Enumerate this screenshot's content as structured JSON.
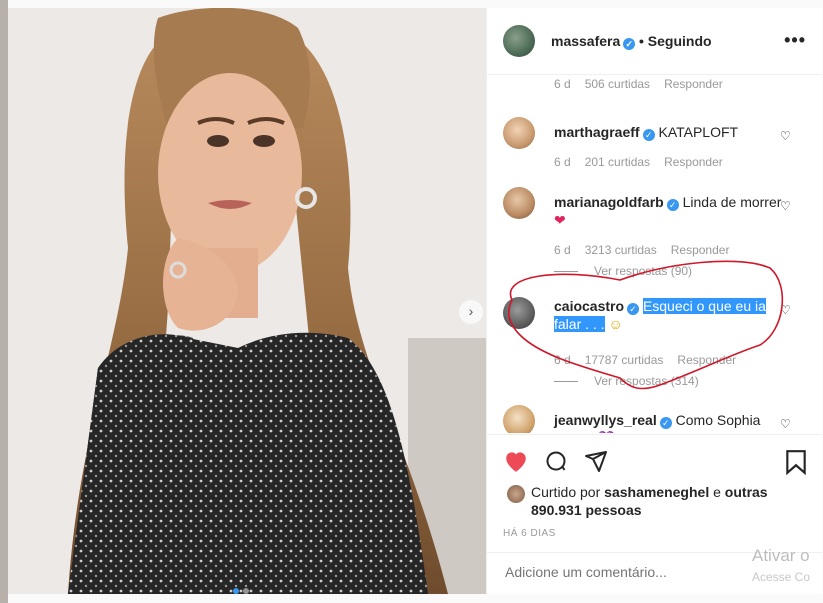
{
  "header": {
    "username": "massafera",
    "verified_glyph": "✓",
    "follow_status": "• Seguindo",
    "more_icon": "more-horizontal-icon"
  },
  "comments": [
    {
      "user": "",
      "text": "",
      "age": "6 d",
      "likes": "506 curtidas",
      "reply": "Responder"
    },
    {
      "user": "marthagraeff",
      "text": "KATAPLOFT",
      "age": "6 d",
      "likes": "201 curtidas",
      "reply": "Responder"
    },
    {
      "user": "marianagoldfarb",
      "text": "Linda de morrer",
      "emoji": "❤",
      "age": "6 d",
      "likes": "3213 curtidas",
      "reply": "Responder",
      "view_replies": "Ver respostas (90)"
    },
    {
      "user": "caiocastro",
      "text": "Esqueci o que eu ia falar . . .",
      "emoji": "☺",
      "age": "6 d",
      "likes": "17787 curtidas",
      "reply": "Responder",
      "view_replies": "Ver respostas (314)"
    },
    {
      "user": "jeanwyllys_real",
      "text": "Como Sophia Loren!",
      "emoji": "💜"
    }
  ],
  "actions": {
    "like_icon": "heart-filled-icon",
    "comment_icon": "comment-icon",
    "share_icon": "share-icon",
    "save_icon": "bookmark-icon",
    "liked_prefix": "Curtido por",
    "liked_user": "sashameneghel",
    "liked_conj": "e",
    "liked_others": "outras 890.931 pessoas",
    "time_ago": "HÁ 6 DIAS"
  },
  "comment_box": {
    "placeholder": "Adicione um comentário..."
  },
  "watermark": {
    "line1": "Ativar o",
    "line2": "Acesse Co"
  },
  "colors": {
    "like": "#ed4956",
    "verified": "#3897f0",
    "highlight": "#3297fd",
    "annotation": "#d0182b"
  }
}
